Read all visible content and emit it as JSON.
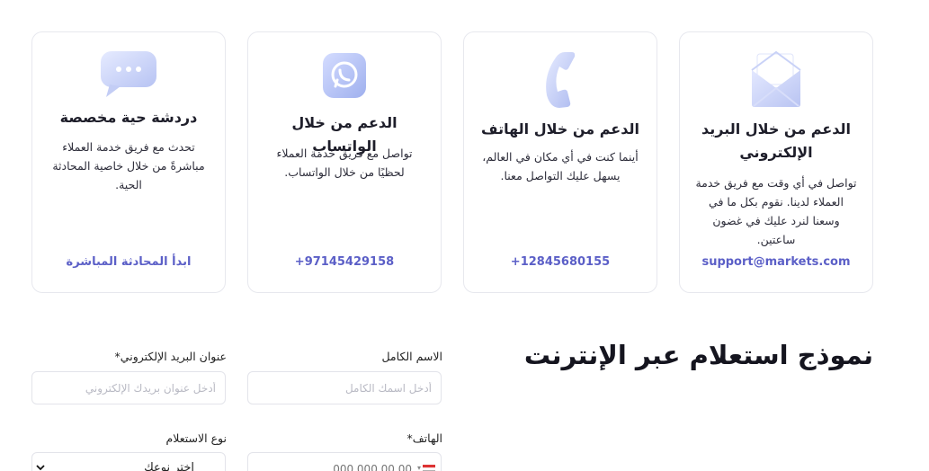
{
  "cards": [
    {
      "title": "الدعم من خلال البريد الإلكتروني",
      "description": "تواصل في أي وقت مع فريق خدمة العملاء لدينا. نقوم بكل ما في وسعنا لنرد عليك في غضون ساعتين.",
      "link": "support@markets.com",
      "icon": "envelope-icon"
    },
    {
      "title": "الدعم من خلال الهاتف",
      "description": "أينما كنت في أي مكان في العالم، يسهل عليك التواصل معنا.",
      "link": "+12845680155",
      "icon": "phone-icon"
    },
    {
      "title": "الدعم من خلال الواتساب",
      "description": "تواصل مع فريق خدمة العملاء لحظيًا من خلال الواتساب.",
      "link": "+97145429158",
      "icon": "whatsapp-icon"
    },
    {
      "title": "دردشة حية مخصصة",
      "description": "تحدث مع فريق خدمة العملاء مباشرةً من خلال خاصية المحادثة الحية.",
      "link": "ابدأ المحادثة المباشرة",
      "icon": "chat-bubble-icon"
    }
  ],
  "form": {
    "title": "نموذج استعلام عبر الإنترنت",
    "full_name_label": "الاسم الكامل",
    "full_name_placeholder": "أدخل اسمك الكامل",
    "email_label": "عنوان البريد الإلكتروني*",
    "email_placeholder": "أدخل عنوان بريدك الإلكتروني",
    "phone_label": "الهاتف*",
    "phone_placeholder": "000 000 00 00",
    "inquiry_type_label": "نوع الاستعلام",
    "inquiry_type_value": "اختر نوعك"
  },
  "colors": {
    "accent": "#5b5fc7",
    "icon_fill": "#c9d2f7"
  }
}
